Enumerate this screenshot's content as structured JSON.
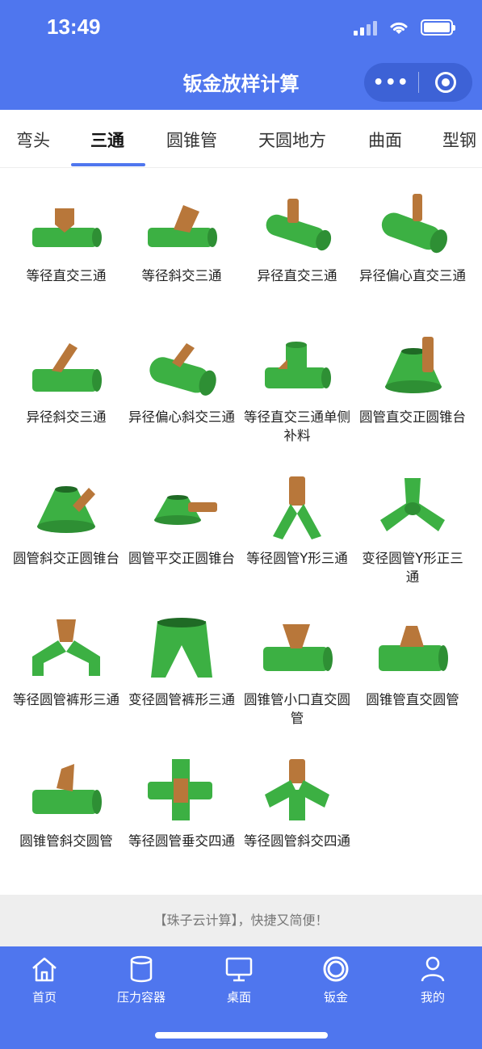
{
  "status": {
    "time": "13:49"
  },
  "header": {
    "title": "钣金放样计算",
    "more_icon": "more-dots-icon",
    "close_icon": "target-icon"
  },
  "tabs": [
    {
      "label": "弯头",
      "active": false
    },
    {
      "label": "三通",
      "active": true
    },
    {
      "label": "圆锥管",
      "active": false
    },
    {
      "label": "天圆地方",
      "active": false
    },
    {
      "label": "曲面",
      "active": false
    },
    {
      "label": "型钢",
      "active": false
    }
  ],
  "items": [
    {
      "label": "等径直交三通"
    },
    {
      "label": "等径斜交三通"
    },
    {
      "label": "异径直交三通"
    },
    {
      "label": "异径偏心直交三通"
    },
    {
      "label": "异径斜交三通"
    },
    {
      "label": "异径偏心斜交三通"
    },
    {
      "label": "等径直交三通单侧补料"
    },
    {
      "label": "圆管直交正圆锥台"
    },
    {
      "label": "圆管斜交正圆锥台"
    },
    {
      "label": "圆管平交正圆锥台"
    },
    {
      "label": "等径圆管Y形三通"
    },
    {
      "label": "变径圆管Y形正三通"
    },
    {
      "label": "等径圆管裤形三通"
    },
    {
      "label": "变径圆管裤形三通"
    },
    {
      "label": "圆锥管小口直交圆管"
    },
    {
      "label": "圆锥管直交圆管"
    },
    {
      "label": "圆锥管斜交圆管"
    },
    {
      "label": "等径圆管垂交四通"
    },
    {
      "label": "等径圆管斜交四通"
    }
  ],
  "footer": {
    "text": "【珠子云计算】，快捷又简便！"
  },
  "bottom_nav": [
    {
      "label": "首页",
      "icon": "home-icon"
    },
    {
      "label": "压力容器",
      "icon": "cylinder-icon"
    },
    {
      "label": "桌面",
      "icon": "monitor-icon"
    },
    {
      "label": "钣金",
      "icon": "ring-icon"
    },
    {
      "label": "我的",
      "icon": "user-icon"
    }
  ],
  "colors": {
    "brand_blue": "#4f76ee",
    "pipe_green": "#3cb043",
    "branch_brown": "#b8773a"
  }
}
